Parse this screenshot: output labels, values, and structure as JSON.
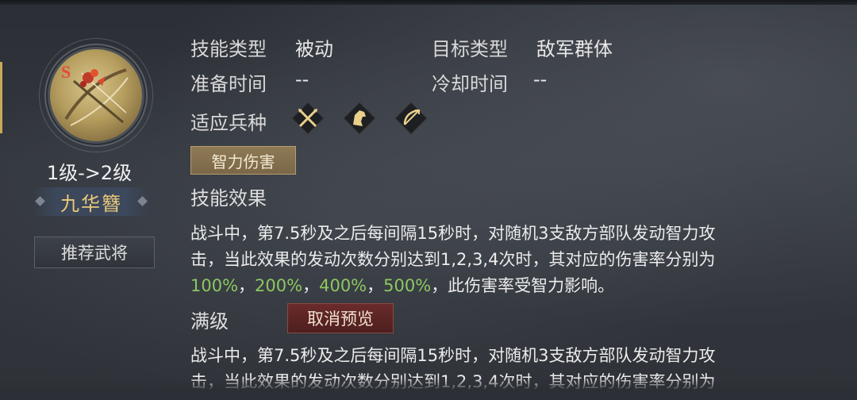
{
  "skill": {
    "icon": "crossbow-skill-icon",
    "icon_badge": "S",
    "level_text": "1级->2级",
    "name": "九华簪",
    "recommend_button": "推荐武将"
  },
  "info": {
    "skill_type_label": "技能类型",
    "skill_type_value": "被动",
    "target_type_label": "目标类型",
    "target_type_value": "敌军群体",
    "prep_time_label": "准备时间",
    "prep_time_value": "--",
    "cooldown_label": "冷却时间",
    "cooldown_value": "--",
    "troop_label": "适应兵种",
    "troops": [
      "spear-icon",
      "cavalry-icon",
      "archer-icon"
    ]
  },
  "damage_tag": "智力伤害",
  "effect": {
    "title": "技能效果",
    "line1": "战斗中，第7.5秒及之后每间隔15秒时，对随机3支敌方部队发动智力攻",
    "line2": "击，当此效果的发动次数分别达到1,2,3,4次时，其对应的伤害率分别为",
    "pct1": "100%",
    "pct2": "200%",
    "pct3": "400%",
    "pct4": "500%",
    "sep": "，",
    "tail": "，此伤害率受智力影响。"
  },
  "max_level": {
    "title": "满级",
    "cancel_button": "取消预览",
    "line1": "战斗中，第7.5秒及之后每间隔15秒时，对随机3支敌方部队发动智力攻",
    "line2": "击，当此效果的发动次数分别达到1,2,3,4次时，其对应的伤害率分别为"
  },
  "colors": {
    "gold": "#e9c97a",
    "green_highlight": "#8cc860",
    "cancel_red": "#5a2323"
  }
}
